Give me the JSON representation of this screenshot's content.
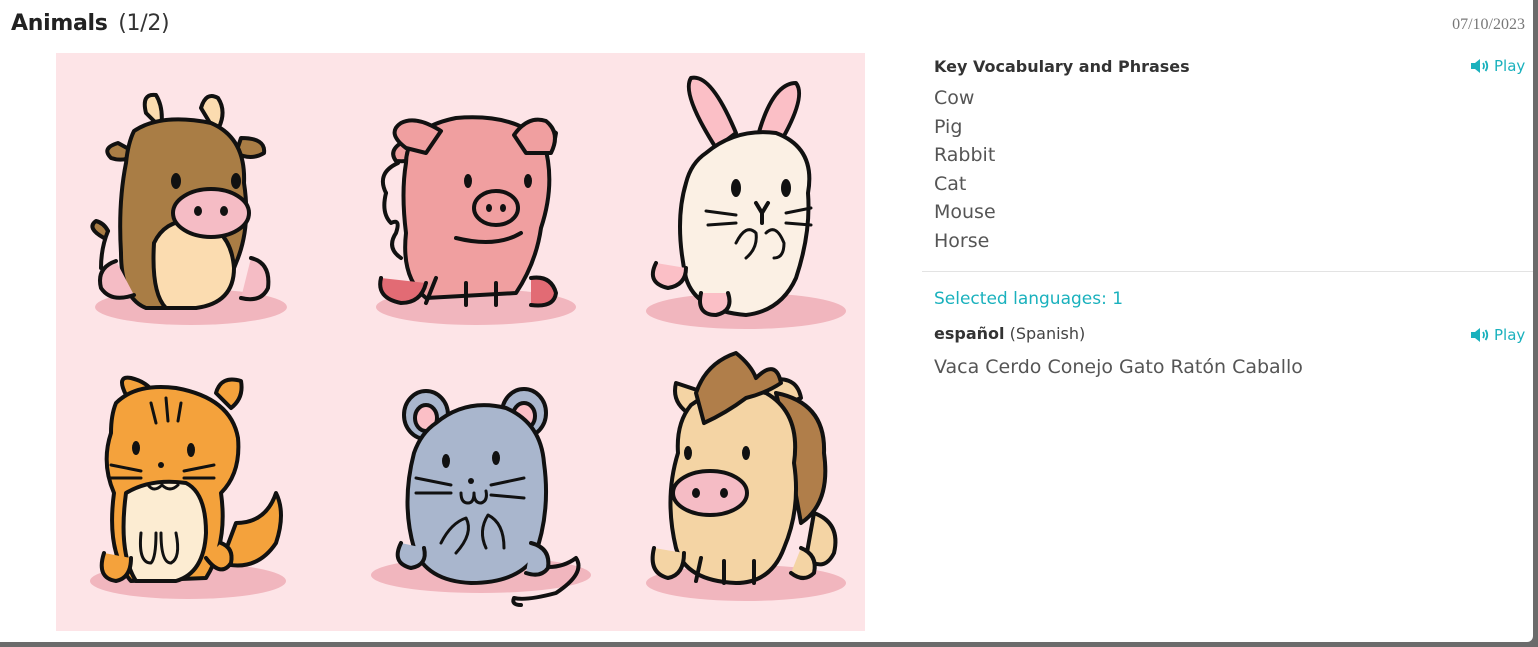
{
  "header": {
    "title": "Animals",
    "count": "(1/2)",
    "date": "07/10/2023"
  },
  "image": {
    "animals": [
      "cow-icon",
      "pig-icon",
      "rabbit-icon",
      "cat-icon",
      "mouse-icon",
      "horse-icon"
    ],
    "background_color": "#fde4e7"
  },
  "vocabulary": {
    "heading": "Key Vocabulary and Phrases",
    "play_label": "Play",
    "items": [
      "Cow",
      "Pig",
      "Rabbit",
      "Cat",
      "Mouse",
      "Horse"
    ]
  },
  "languages": {
    "selected_text": "Selected languages: 1",
    "items": [
      {
        "name": "español",
        "native": "(Spanish)",
        "play_label": "Play",
        "translation": "Vaca Cerdo Conejo Gato Ratón Caballo"
      }
    ]
  },
  "colors": {
    "accent": "#1ab1bd",
    "text": "#555555"
  }
}
